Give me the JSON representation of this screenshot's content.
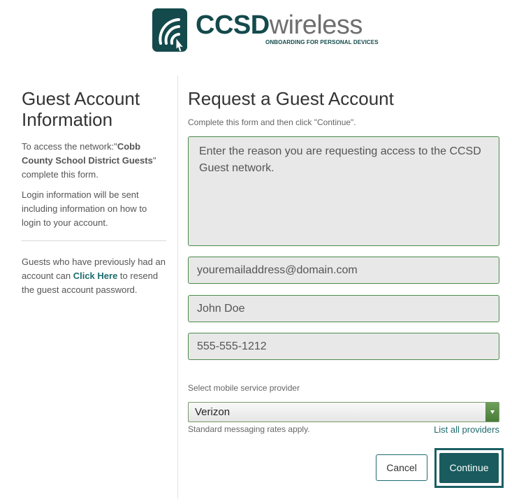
{
  "header": {
    "brand_bold": "CCSD",
    "brand_light": "wireless",
    "tagline": "ONBOARDING FOR PERSONAL DEVICES"
  },
  "left": {
    "title": "Guest Account Information",
    "network_prefix": "To access the network:\"",
    "network_name": "Cobb County School District Guests",
    "network_suffix": "\" complete this form.",
    "login_info": "Login information will be sent including information on how to login to your account.",
    "guests_prefix": "Guests who have previously had an account can ",
    "click_here": "Click Here",
    "guests_suffix": " to resend the guest account password."
  },
  "form": {
    "title": "Request a Guest Account",
    "instructions": "Complete this form and then click \"Continue\".",
    "reason_placeholder": "Enter the reason you are requesting access to the CCSD Guest network.",
    "email_placeholder": "youremailaddress@domain.com",
    "name_placeholder": "John Doe",
    "phone_placeholder": "555-555-1212",
    "provider_label": "Select mobile service provider",
    "provider_selected": "Verizon",
    "rates_note": "Standard messaging rates apply.",
    "list_all_link": "List all providers",
    "cancel_label": "Cancel",
    "continue_label": "Continue"
  },
  "colors": {
    "brand": "#144a4c",
    "link": "#1e6b6e",
    "field_border": "#4c8a4c",
    "field_bg": "#e8e8e8"
  },
  "icons": {
    "logo": "wifi-cursor-icon",
    "select_arrow": "chevron-down-icon"
  }
}
